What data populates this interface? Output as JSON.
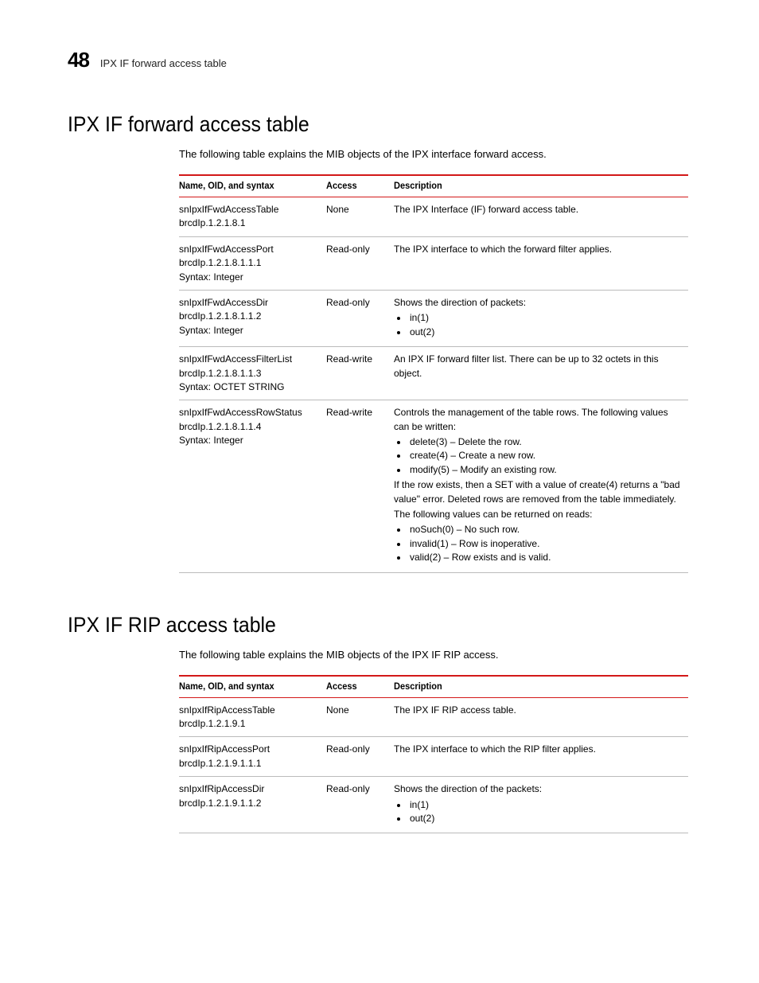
{
  "header": {
    "chapter": "48",
    "running": "IPX IF forward access table"
  },
  "section1": {
    "title": "IPX IF forward access table",
    "intro": "The following table explains the MIB objects of the IPX interface forward access.",
    "headers": {
      "c1": "Name, OID, and syntax",
      "c2": "Access",
      "c3": "Description"
    },
    "rows": [
      {
        "name1": "snIpxIfFwdAccessTable",
        "name2": "brcdIp.1.2.1.8.1",
        "name3": "",
        "access": "None",
        "desc_type": "text",
        "desc_text": "The IPX Interface (IF) forward access table."
      },
      {
        "name1": "snIpxIfFwdAccessPort",
        "name2": "brcdIp.1.2.1.8.1.1.1",
        "name3": "Syntax: Integer",
        "access": "Read-only",
        "desc_type": "text",
        "desc_text": "The IPX interface to which the forward filter applies."
      },
      {
        "name1": "snIpxIfFwdAccessDir",
        "name2": "brcdIp.1.2.1.8.1.1.2",
        "name3": "Syntax: Integer",
        "access": "Read-only",
        "desc_type": "list1",
        "desc_lead": "Shows the direction of packets:",
        "desc_items": [
          "in(1)",
          "out(2)"
        ]
      },
      {
        "name1": "snIpxIfFwdAccessFilterList",
        "name2": "brcdIp.1.2.1.8.1.1.3",
        "name3": "Syntax: OCTET STRING",
        "access": "Read-write",
        "desc_type": "text",
        "desc_text": "An IPX IF forward filter list. There can be up to 32 octets in this object."
      },
      {
        "name1": "snIpxIfFwdAccessRowStatus",
        "name2": "brcdIp.1.2.1.8.1.1.4",
        "name3": "Syntax: Integer",
        "access": "Read-write",
        "desc_type": "rowstatus",
        "p1": "Controls the management of the table rows. The following values can be written:",
        "list1": [
          "delete(3) – Delete the row.",
          "create(4) – Create a new row.",
          "modify(5) – Modify an existing row."
        ],
        "p2": "If the row exists, then a SET with a value of create(4) returns a \"bad value\" error. Deleted rows are removed from the table immediately.",
        "p3": "The following values can be returned on reads:",
        "list2": [
          "noSuch(0) – No such row.",
          "invalid(1) – Row is inoperative.",
          "valid(2) – Row exists and is valid."
        ]
      }
    ]
  },
  "section2": {
    "title": "IPX IF RIP access table",
    "intro": "The following table explains the MIB objects of the IPX IF RIP access.",
    "headers": {
      "c1": "Name, OID, and syntax",
      "c2": "Access",
      "c3": "Description"
    },
    "rows": [
      {
        "name1": "snIpxIfRipAccessTable",
        "name2": "brcdIp.1.2.1.9.1",
        "name3": "",
        "access": "None",
        "desc_type": "text",
        "desc_text": "The IPX IF RIP access table."
      },
      {
        "name1": "snIpxIfRipAccessPort",
        "name2": "brcdIp.1.2.1.9.1.1.1",
        "name3": "",
        "access": "Read-only",
        "desc_type": "text",
        "desc_text": "The IPX interface to which the RIP filter applies."
      },
      {
        "name1": "snIpxIfRipAccessDir",
        "name2": "brcdIp.1.2.1.9.1.1.2",
        "name3": "",
        "access": "Read-only",
        "desc_type": "list1",
        "desc_lead": "Shows the direction of the packets:",
        "desc_items": [
          "in(1)",
          "out(2)"
        ]
      }
    ]
  }
}
